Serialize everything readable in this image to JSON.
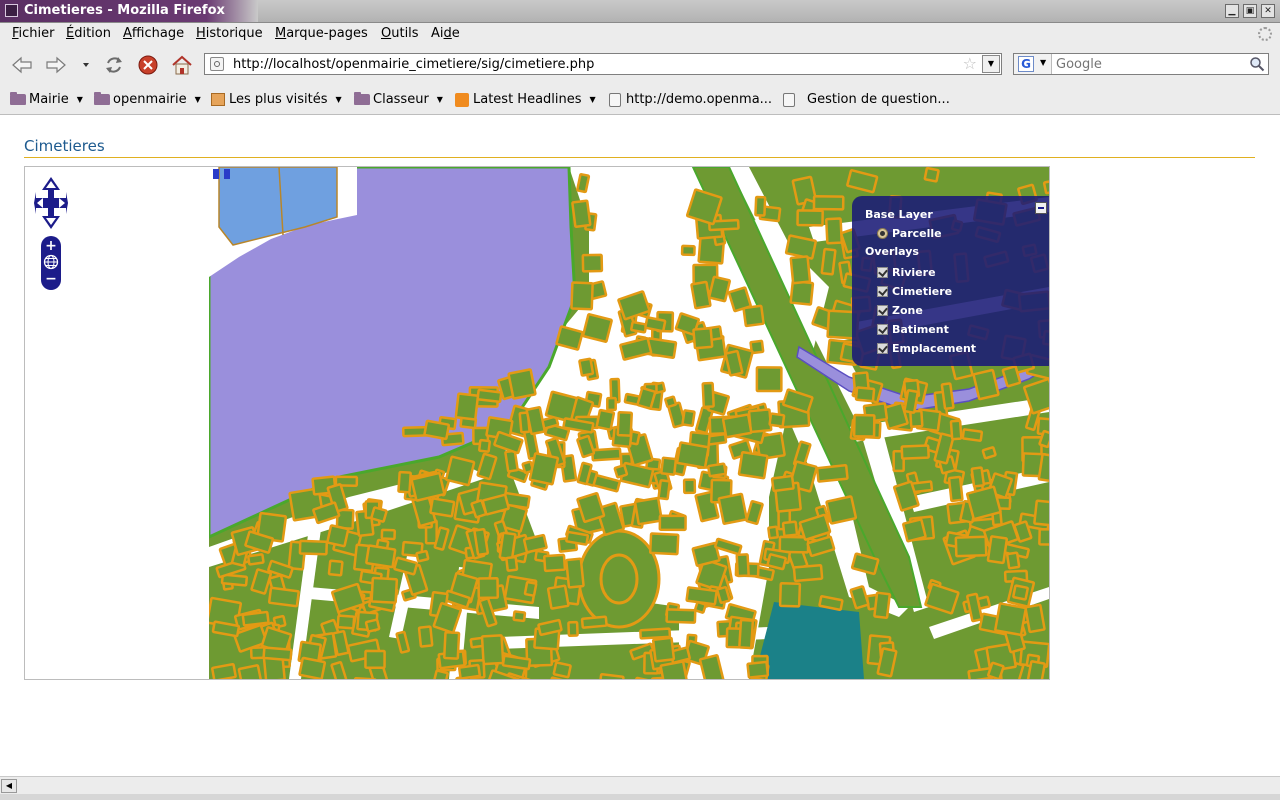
{
  "window": {
    "title": "Cimetieres - Mozilla Firefox",
    "controls": {
      "minimize": "▁",
      "restore": "▣",
      "close": "✕"
    }
  },
  "menu": {
    "fichier": {
      "ul": "F",
      "rest": "ichier"
    },
    "edition": {
      "ul": "É",
      "rest": "dition"
    },
    "affichage": {
      "ul": "A",
      "rest": "ffichage"
    },
    "historique": {
      "ul": "H",
      "rest": "istorique"
    },
    "marque_pages": {
      "ul": "M",
      "rest": "arque-pages"
    },
    "outils": {
      "ul": "O",
      "rest": "utils"
    },
    "aide": {
      "pre": "Ai",
      "ul": "d",
      "rest": "e"
    }
  },
  "navigation": {
    "url": "http://localhost/openmairie_cimetiere/sig/cimetiere.php",
    "search_placeholder": "Google",
    "search_engine_letter": "G"
  },
  "bookmarks": [
    {
      "label": "Mairie",
      "kind": "folder"
    },
    {
      "label": "openmairie",
      "kind": "folder"
    },
    {
      "label": "Les plus visités",
      "kind": "smart-folder"
    },
    {
      "label": "Classeur",
      "kind": "folder"
    },
    {
      "label": "Latest Headlines",
      "kind": "rss"
    },
    {
      "label": "http://demo.openma...",
      "kind": "page"
    },
    {
      "label": "Gestion de question...",
      "kind": "page"
    }
  ],
  "page": {
    "title": "Cimetieres"
  },
  "map": {
    "zoom_in": "+",
    "zoom_out": "−",
    "colors": {
      "parcel_fill": "#6e9a32",
      "building_fill": "#e39a14",
      "river_fill": "#9a8fdc",
      "cemetery_fill": "#6fa0e0",
      "zone_fill": "#1b8188",
      "road_fill": "#ffffff",
      "layer_panel": "#1a1a76"
    },
    "layer_switcher": {
      "base_layer_title": "Base Layer",
      "base_layers": [
        {
          "label": "Parcelle",
          "selected": true
        }
      ],
      "overlays_title": "Overlays",
      "overlays": [
        {
          "label": "Riviere",
          "checked": true
        },
        {
          "label": "Cimetiere",
          "checked": true
        },
        {
          "label": "Zone",
          "checked": true
        },
        {
          "label": "Batiment",
          "checked": true
        },
        {
          "label": "Emplacement",
          "checked": true
        }
      ]
    }
  }
}
